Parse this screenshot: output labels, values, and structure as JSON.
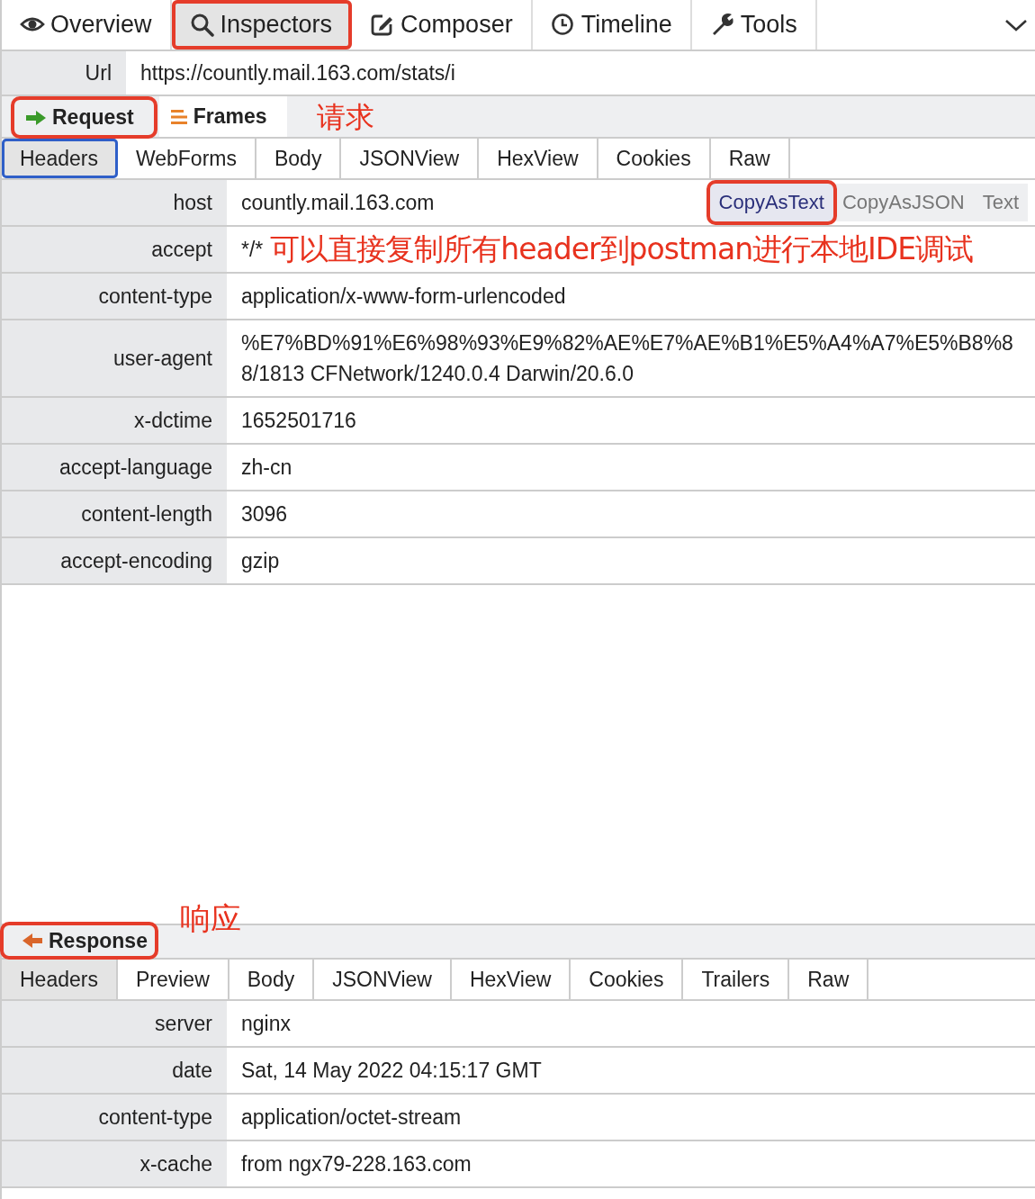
{
  "top_tabs": [
    {
      "label": "Overview",
      "selected": false,
      "highlighted": false
    },
    {
      "label": "Inspectors",
      "selected": true,
      "highlighted": true
    },
    {
      "label": "Composer",
      "selected": false,
      "highlighted": false
    },
    {
      "label": "Timeline",
      "selected": false,
      "highlighted": false
    },
    {
      "label": "Tools",
      "selected": false,
      "highlighted": false
    }
  ],
  "url": {
    "label": "Url",
    "value": "https://countly.mail.163.com/stats/i"
  },
  "request": {
    "annotation": "请求",
    "tabs": [
      {
        "label": "Request",
        "selected": true,
        "highlighted": true
      },
      {
        "label": "Frames",
        "selected": false,
        "highlighted": false
      }
    ],
    "subtabs": [
      {
        "label": "Headers",
        "selected": true,
        "focused": true
      },
      {
        "label": "WebForms",
        "selected": false,
        "focused": false
      },
      {
        "label": "Body",
        "selected": false,
        "focused": false
      },
      {
        "label": "JSONView",
        "selected": false,
        "focused": false
      },
      {
        "label": "HexView",
        "selected": false,
        "focused": false
      },
      {
        "label": "Cookies",
        "selected": false,
        "focused": false
      },
      {
        "label": "Raw",
        "selected": false,
        "focused": false
      }
    ],
    "copy_buttons": [
      {
        "label": "CopyAsText",
        "selected": true,
        "highlighted": true
      },
      {
        "label": "CopyAsJSON",
        "selected": false,
        "highlighted": false
      },
      {
        "label": "Text",
        "selected": false,
        "highlighted": false
      }
    ],
    "headers_annotation": "可以直接复制所有header到postman进行本地IDE调试",
    "headers": [
      {
        "name": "host",
        "value": "countly.mail.163.com"
      },
      {
        "name": "accept",
        "value": "*/*"
      },
      {
        "name": "content-type",
        "value": "application/x-www-form-urlencoded"
      },
      {
        "name": "user-agent",
        "value": "%E7%BD%91%E6%98%93%E9%82%AE%E7%AE%B1%E5%A4%A7%E5%B8%88/1813 CFNetwork/1240.0.4 Darwin/20.6.0"
      },
      {
        "name": "x-dctime",
        "value": "1652501716"
      },
      {
        "name": "accept-language",
        "value": "zh-cn"
      },
      {
        "name": "content-length",
        "value": "3096"
      },
      {
        "name": "accept-encoding",
        "value": "gzip"
      }
    ]
  },
  "response": {
    "annotation": "响应",
    "tab": {
      "label": "Response",
      "highlighted": true
    },
    "subtabs": [
      {
        "label": "Headers",
        "selected": true
      },
      {
        "label": "Preview",
        "selected": false
      },
      {
        "label": "Body",
        "selected": false
      },
      {
        "label": "JSONView",
        "selected": false
      },
      {
        "label": "HexView",
        "selected": false
      },
      {
        "label": "Cookies",
        "selected": false
      },
      {
        "label": "Trailers",
        "selected": false
      },
      {
        "label": "Raw",
        "selected": false
      }
    ],
    "headers": [
      {
        "name": "server",
        "value": "nginx"
      },
      {
        "name": "date",
        "value": "Sat, 14 May 2022 04:15:17 GMT"
      },
      {
        "name": "content-type",
        "value": "application/octet-stream"
      },
      {
        "name": "x-cache",
        "value": "from ngx79-228.163.com"
      }
    ]
  }
}
